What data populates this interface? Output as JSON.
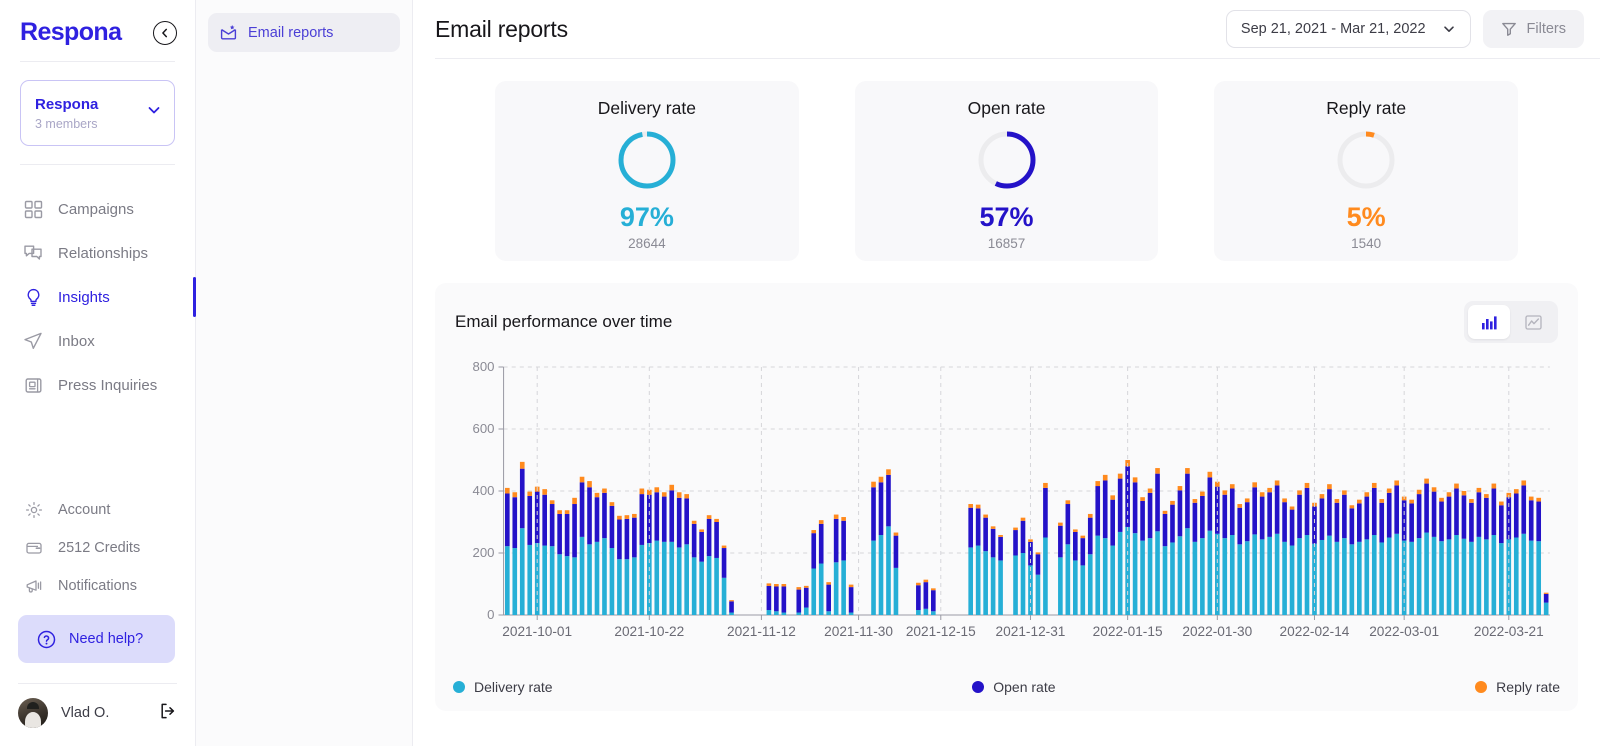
{
  "sidebar": {
    "logo": "Respona",
    "collapse_icon": "chevron-left-circle-icon",
    "workspace": {
      "name": "Respona",
      "members": "3 members",
      "chevron_icon": "chevron-down-icon"
    },
    "items": [
      {
        "label": "Campaigns",
        "icon": "grid-icon",
        "active": false
      },
      {
        "label": "Relationships",
        "icon": "chat-bubbles-icon",
        "active": false
      },
      {
        "label": "Insights",
        "icon": "lightbulb-icon",
        "active": true
      },
      {
        "label": "Inbox",
        "icon": "paper-plane-icon",
        "active": false
      },
      {
        "label": "Press Inquiries",
        "icon": "press-panel-icon",
        "active": false
      }
    ],
    "bottom_items": [
      {
        "label": "Account",
        "icon": "gear-icon"
      },
      {
        "label": "2512 Credits",
        "icon": "credits-card-icon"
      },
      {
        "label": "Notifications",
        "icon": "megaphone-icon"
      }
    ],
    "help": {
      "label": "Need help?",
      "icon": "question-circle-icon"
    },
    "user": {
      "name": "Vlad O.",
      "avatar": "avatar",
      "logout_icon": "logout-icon"
    }
  },
  "subnav": {
    "items": [
      {
        "label": "Email reports",
        "icon": "email-report-icon",
        "active": true
      }
    ]
  },
  "header": {
    "title": "Email reports",
    "date_range": "Sep 21, 2021 - Mar 21, 2022",
    "date_chevron_icon": "chevron-down-icon",
    "filters_label": "Filters",
    "filters_icon": "funnel-icon"
  },
  "cards": [
    {
      "title": "Delivery rate",
      "percent": "97%",
      "count": "28644",
      "value": 97,
      "color": "#26AFD6"
    },
    {
      "title": "Open rate",
      "percent": "57%",
      "count": "16857",
      "value": 57,
      "color": "#2412C8"
    },
    {
      "title": "Reply rate",
      "percent": "5%",
      "count": "1540",
      "value": 5,
      "color": "#FF8A1E"
    }
  ],
  "panel": {
    "title": "Email performance over time",
    "toggle": [
      {
        "name": "bar-chart-view",
        "icon": "bar-chart-icon",
        "active": true
      },
      {
        "name": "line-chart-view",
        "icon": "line-chart-icon",
        "active": false
      }
    ]
  },
  "chart_data": {
    "type": "bar",
    "title": "Email performance over time",
    "stacked": true,
    "xlabel": "",
    "ylabel": "",
    "ylim": [
      0,
      800
    ],
    "yticks": [
      0,
      200,
      400,
      600,
      800
    ],
    "grid": true,
    "legend_position": "bottom",
    "xtick_labels": [
      "2021-10-01",
      "2021-10-22",
      "2021-11-12",
      "2021-11-30",
      "2021-12-15",
      "2021-12-31",
      "2022-01-15",
      "2022-01-30",
      "2022-02-14",
      "2022-03-01",
      "2022-03-21"
    ],
    "xtick_positions": [
      4,
      19,
      34,
      47,
      58,
      70,
      83,
      95,
      108,
      120,
      134
    ],
    "series": [
      {
        "name": "Delivery rate",
        "color": "#26AFD6",
        "values": [
          222,
          216,
          280,
          226,
          232,
          224,
          222,
          196,
          190,
          186,
          252,
          228,
          236,
          248,
          216,
          180,
          180,
          186,
          226,
          232,
          240,
          236,
          236,
          218,
          228,
          186,
          172,
          190,
          184,
          120,
          8,
          0,
          0,
          0,
          0,
          16,
          12,
          8,
          0,
          8,
          24,
          150,
          166,
          12,
          170,
          176,
          8,
          0,
          0,
          240,
          258,
          286,
          152,
          0,
          0,
          16,
          20,
          12,
          0,
          0,
          0,
          0,
          218,
          224,
          206,
          186,
          176,
          0,
          192,
          200,
          160,
          130,
          250,
          0,
          186,
          228,
          176,
          160,
          196,
          256,
          248,
          224,
          268,
          284,
          264,
          240,
          248,
          270,
          222,
          234,
          254,
          280,
          236,
          248,
          272,
          262,
          248,
          258,
          228,
          238,
          260,
          244,
          252,
          262,
          236,
          224,
          248,
          258,
          230,
          242,
          256,
          236,
          248,
          228,
          236,
          244,
          258,
          234,
          250,
          262,
          240,
          236,
          248,
          266,
          252,
          238,
          244,
          258,
          246,
          236,
          252,
          244,
          258,
          232,
          244,
          250,
          262,
          240,
          238,
          40
        ]
      },
      {
        "name": "Open rate",
        "color": "#2412C8",
        "values": [
          170,
          164,
          192,
          158,
          166,
          164,
          136,
          130,
          136,
          172,
          176,
          184,
          144,
          146,
          136,
          128,
          130,
          128,
          164,
          156,
          156,
          146,
          166,
          160,
          148,
          108,
          96,
          120,
          116,
          96,
          36,
          0,
          0,
          0,
          0,
          78,
          80,
          84,
          0,
          74,
          64,
          114,
          128,
          86,
          140,
          128,
          82,
          0,
          0,
          172,
          170,
          166,
          104,
          0,
          0,
          80,
          86,
          68,
          0,
          0,
          0,
          0,
          128,
          120,
          108,
          92,
          76,
          0,
          82,
          104,
          76,
          66,
          160,
          0,
          102,
          130,
          92,
          88,
          118,
          160,
          186,
          148,
          172,
          196,
          164,
          128,
          146,
          186,
          104,
          122,
          148,
          176,
          126,
          136,
          172,
          152,
          140,
          150,
          118,
          126,
          152,
          138,
          144,
          156,
          128,
          116,
          140,
          152,
          120,
          134,
          150,
          126,
          140,
          116,
          124,
          138,
          152,
          128,
          144,
          156,
          130,
          124,
          142,
          158,
          146,
          128,
          138,
          150,
          140,
          126,
          144,
          134,
          150,
          122,
          136,
          142,
          156,
          130,
          128,
          28
        ]
      },
      {
        "name": "Reply rate",
        "color": "#FF8A1E",
        "values": [
          18,
          16,
          22,
          14,
          16,
          18,
          12,
          12,
          12,
          20,
          18,
          20,
          14,
          14,
          12,
          12,
          12,
          12,
          18,
          16,
          16,
          14,
          18,
          18,
          14,
          10,
          8,
          12,
          10,
          8,
          4,
          0,
          0,
          0,
          0,
          8,
          8,
          8,
          0,
          8,
          6,
          10,
          12,
          8,
          14,
          12,
          8,
          0,
          0,
          18,
          18,
          18,
          10,
          0,
          0,
          8,
          8,
          6,
          0,
          0,
          0,
          0,
          12,
          12,
          10,
          8,
          6,
          0,
          8,
          10,
          8,
          6,
          16,
          0,
          10,
          12,
          8,
          8,
          12,
          16,
          18,
          14,
          16,
          20,
          16,
          12,
          14,
          18,
          10,
          12,
          14,
          18,
          12,
          14,
          18,
          16,
          14,
          14,
          12,
          12,
          16,
          14,
          14,
          16,
          12,
          10,
          14,
          16,
          12,
          14,
          16,
          12,
          14,
          10,
          12,
          14,
          16,
          12,
          14,
          16,
          12,
          12,
          14,
          16,
          14,
          12,
          14,
          16,
          14,
          12,
          14,
          12,
          16,
          12,
          14,
          14,
          16,
          12,
          12,
          4
        ]
      }
    ],
    "legend": [
      {
        "label": "Delivery rate",
        "color": "#26AFD6"
      },
      {
        "label": "Open rate",
        "color": "#2412C8"
      },
      {
        "label": "Reply rate",
        "color": "#FF8A1E"
      }
    ]
  }
}
